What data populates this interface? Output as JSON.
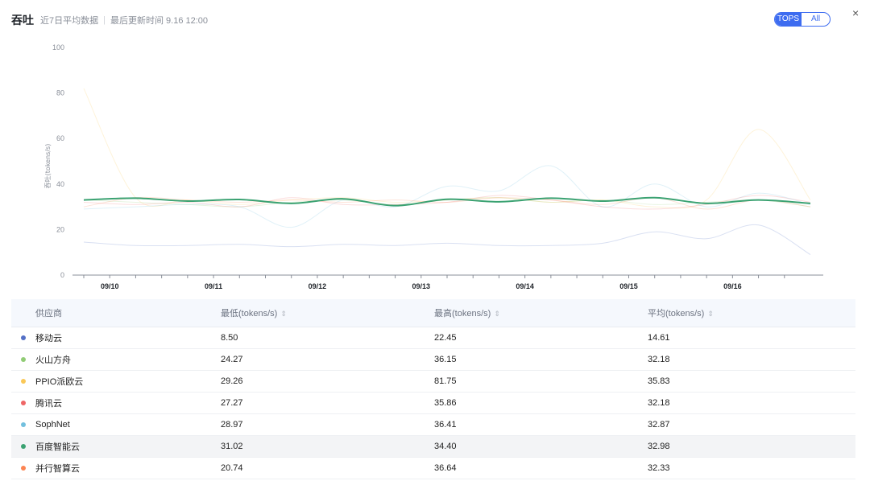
{
  "header": {
    "title": "吞吐",
    "subtitle": "近7日平均数据",
    "separator": "|",
    "updated": "最后更新时间 9.16 12:00"
  },
  "toggle": {
    "tops": "TOPS",
    "all": "All",
    "active": "all"
  },
  "close_icon": "close-icon",
  "chart_data": {
    "type": "line",
    "ylabel": "吞吐(tokens/s)",
    "ylim": [
      0,
      100
    ],
    "yticks": [
      "0",
      "20",
      "40",
      "60",
      "80",
      "100"
    ],
    "categories": [
      "09/10",
      "09/11",
      "09/12",
      "09/13",
      "09/14",
      "09/15",
      "09/16"
    ],
    "x": [
      0,
      0.5,
      1,
      1.5,
      2,
      2.5,
      3,
      3.5,
      4,
      4.5,
      5,
      5.5,
      6,
      6.5,
      7
    ],
    "grid": false,
    "legend": "none",
    "highlight_series": "百度智能云",
    "series": [
      {
        "name": "移动云",
        "color": "#5470c6",
        "values": [
          14.5,
          13,
          13,
          13.5,
          12.5,
          13.5,
          13,
          14,
          13,
          13,
          14,
          19,
          16,
          22,
          9
        ]
      },
      {
        "name": "火山方舟",
        "color": "#91cc75",
        "values": [
          33,
          32,
          31,
          30,
          32,
          33,
          31,
          33,
          34,
          32,
          33,
          31,
          32,
          33,
          30
        ]
      },
      {
        "name": "PPIO派欧云",
        "color": "#fac858",
        "values": [
          82,
          34,
          33,
          31,
          33,
          34,
          32,
          33,
          34,
          32,
          33,
          30,
          33,
          64,
          33
        ]
      },
      {
        "name": "腾讯云",
        "color": "#ee6666",
        "values": [
          32,
          31,
          32,
          30,
          34,
          31,
          31,
          32,
          35,
          33,
          30,
          29,
          31,
          35,
          32
        ]
      },
      {
        "name": "SophNet",
        "color": "#73c0de",
        "values": [
          29,
          30,
          31,
          30,
          21,
          33,
          30,
          39,
          37,
          48,
          30,
          40,
          30,
          36,
          31
        ]
      },
      {
        "name": "百度智能云",
        "color": "#3ba272",
        "values": [
          33,
          33.8,
          32.5,
          33.2,
          31.5,
          33.5,
          30.5,
          33.3,
          32.2,
          33.8,
          32.5,
          34,
          31.5,
          33,
          31.5
        ]
      },
      {
        "name": "并行智算云",
        "color": "#fc8452",
        "values": [
          30,
          34,
          33,
          32,
          33,
          32,
          33,
          32,
          34,
          33,
          31,
          34,
          29,
          33,
          30
        ]
      }
    ]
  },
  "table": {
    "columns": [
      "供应商",
      "最低(tokens/s)",
      "最高(tokens/s)",
      "平均(tokens/s)"
    ],
    "sort_icon": "sort-icon",
    "rows": [
      {
        "provider": "移动云",
        "min": "8.50",
        "max": "22.45",
        "avg": "14.61",
        "color": "#5470c6"
      },
      {
        "provider": "火山方舟",
        "min": "24.27",
        "max": "36.15",
        "avg": "32.18",
        "color": "#91cc75"
      },
      {
        "provider": "PPIO派欧云",
        "min": "29.26",
        "max": "81.75",
        "avg": "35.83",
        "color": "#fac858"
      },
      {
        "provider": "腾讯云",
        "min": "27.27",
        "max": "35.86",
        "avg": "32.18",
        "color": "#ee6666"
      },
      {
        "provider": "SophNet",
        "min": "28.97",
        "max": "36.41",
        "avg": "32.87",
        "color": "#73c0de"
      },
      {
        "provider": "百度智能云",
        "min": "31.02",
        "max": "34.40",
        "avg": "32.98",
        "color": "#3ba272"
      },
      {
        "provider": "并行智算云",
        "min": "20.74",
        "max": "36.64",
        "avg": "32.33",
        "color": "#fc8452"
      }
    ]
  }
}
